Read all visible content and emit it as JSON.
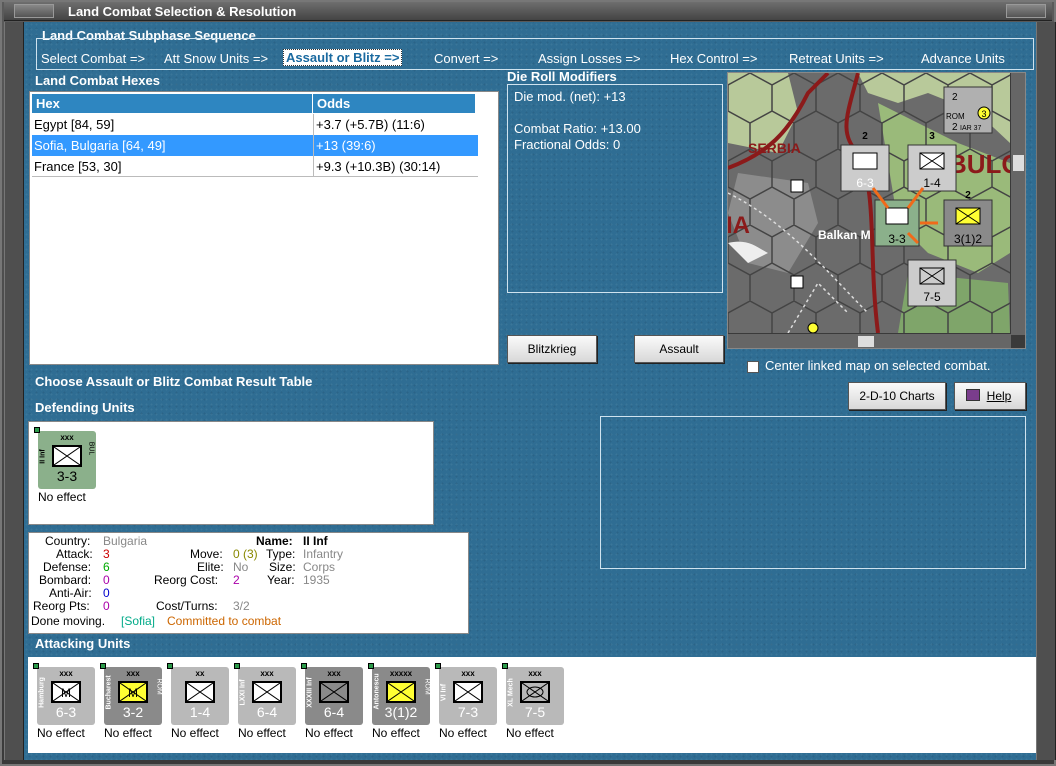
{
  "window_title": "Land Combat Selection & Resolution",
  "subphase": {
    "title": "Land Combat Subphase Sequence",
    "steps": [
      "Select Combat =>",
      "Att Snow Units =>",
      "Assault or Blitz =>",
      "Convert =>",
      "Assign Losses =>",
      "Hex Control =>",
      "Retreat Units =>",
      "Advance Units"
    ],
    "selected_index": 2
  },
  "hexes": {
    "title": "Land Combat Hexes",
    "columns": [
      "Hex",
      "Odds"
    ],
    "rows": [
      {
        "hex": "Egypt [84, 59]",
        "odds": "+3.7 (+5.7B) (11:6)"
      },
      {
        "hex": "Sofia, Bulgaria [64, 49]",
        "odds": "+13 (39:6)"
      },
      {
        "hex": "France [53, 30]",
        "odds": "+9.3 (+10.3B) (30:14)"
      }
    ],
    "selected_index": 1
  },
  "drm": {
    "title": "Die Roll Modifiers",
    "line1": "Die mod. (net): +13",
    "line2": "Combat Ratio: +13.00",
    "line3": "Fractional Odds: 0"
  },
  "buttons": {
    "blitz": "Blitzkrieg",
    "assault": "Assault",
    "charts": "2-D-10 Charts",
    "help": "Help"
  },
  "center_map_label": "Center linked map on selected combat.",
  "choose_crt_label": "Choose Assault or Blitz Combat Result Table",
  "map": {
    "labels": {
      "serbia": "SERBIA",
      "bulgaria": "BULGAI",
      "via": "IA",
      "balkan": "Balkan M"
    },
    "unit_labels": [
      "6-3",
      "1-4",
      "3(1)2",
      "7-5",
      "3-3"
    ],
    "stack_counts": [
      "2",
      "3",
      "2"
    ],
    "air_unit": {
      "nation": "ROM",
      "name": "IAR 37",
      "values": [
        "2",
        "2",
        "3"
      ]
    }
  },
  "defending": {
    "title": "Defending Units",
    "units": [
      {
        "name": "II Inf",
        "size": "xxx",
        "strength": "3-3",
        "nation": "BUL",
        "color": "#8bb08b",
        "effect": "No effect",
        "symbol": "inf"
      }
    ]
  },
  "info": {
    "country_label": "Country:",
    "country": "Bulgaria",
    "attack_label": "Attack:",
    "attack": "3",
    "defense_label": "Defense:",
    "defense": "6",
    "bombard_label": "Bombard:",
    "bombard": "0",
    "antiair_label": "Anti-Air:",
    "antiair": "0",
    "reorg_label": "Reorg Pts:",
    "reorg": "0",
    "name_label": "Name:",
    "name": "II Inf",
    "move_label": "Move:",
    "move": "0 (3)",
    "type_label": "Type:",
    "type": "Infantry",
    "elite_label": "Elite:",
    "elite": "No",
    "size_label": "Size:",
    "size": "Corps",
    "reorgcost_label": "Reorg Cost:",
    "reorgcost": "2",
    "year_label": "Year:",
    "year": "1935",
    "costturns_label": "Cost/Turns:",
    "costturns": "3/2",
    "done_prefix": "Done moving.",
    "done_hex": "[Sofia]",
    "done_status": "Committed to combat"
  },
  "attacking": {
    "title": "Attacking Units",
    "units": [
      {
        "name": "Hamburg",
        "size": "xxx",
        "strength": "6-3",
        "color": "#b9b9b9",
        "box": "#ffffff",
        "symbol": "mot",
        "nation": "",
        "effect": "No effect"
      },
      {
        "name": "Bucharest",
        "size": "xxx",
        "strength": "3-2",
        "color": "#8a8a8a",
        "box": "#ffff33",
        "symbol": "mot",
        "nation": "ROM",
        "effect": "No effect"
      },
      {
        "name": "",
        "size": "xx",
        "strength": "1-4",
        "color": "#b9b9b9",
        "box": "#ffffff",
        "symbol": "inf",
        "nation": "",
        "effect": "No effect"
      },
      {
        "name": "LXXI Inf",
        "size": "xxx",
        "strength": "6-4",
        "color": "#b9b9b9",
        "box": "#ffffff",
        "symbol": "inf",
        "nation": "",
        "effect": "No effect"
      },
      {
        "name": "XXXIII Inf",
        "size": "xxx",
        "strength": "6-4",
        "color": "#8a8a8a",
        "box": "#8a8a8a",
        "symbol": "inf",
        "nation": "",
        "effect": "No effect"
      },
      {
        "name": "Antonescu",
        "size": "xxxxx",
        "strength": "3(1)2",
        "color": "#8a8a8a",
        "box": "#ffff33",
        "symbol": "inf",
        "nation": "ROM",
        "effect": "No effect"
      },
      {
        "name": "VI Inf",
        "size": "xxx",
        "strength": "7-3",
        "color": "#b9b9b9",
        "box": "#ffffff",
        "symbol": "inf",
        "nation": "",
        "effect": "No effect"
      },
      {
        "name": "XL Mech",
        "size": "xxx",
        "strength": "7-5",
        "color": "#b9b9b9",
        "box": "#b9b9b9",
        "symbol": "mech",
        "nation": "",
        "effect": "No effect"
      }
    ]
  }
}
